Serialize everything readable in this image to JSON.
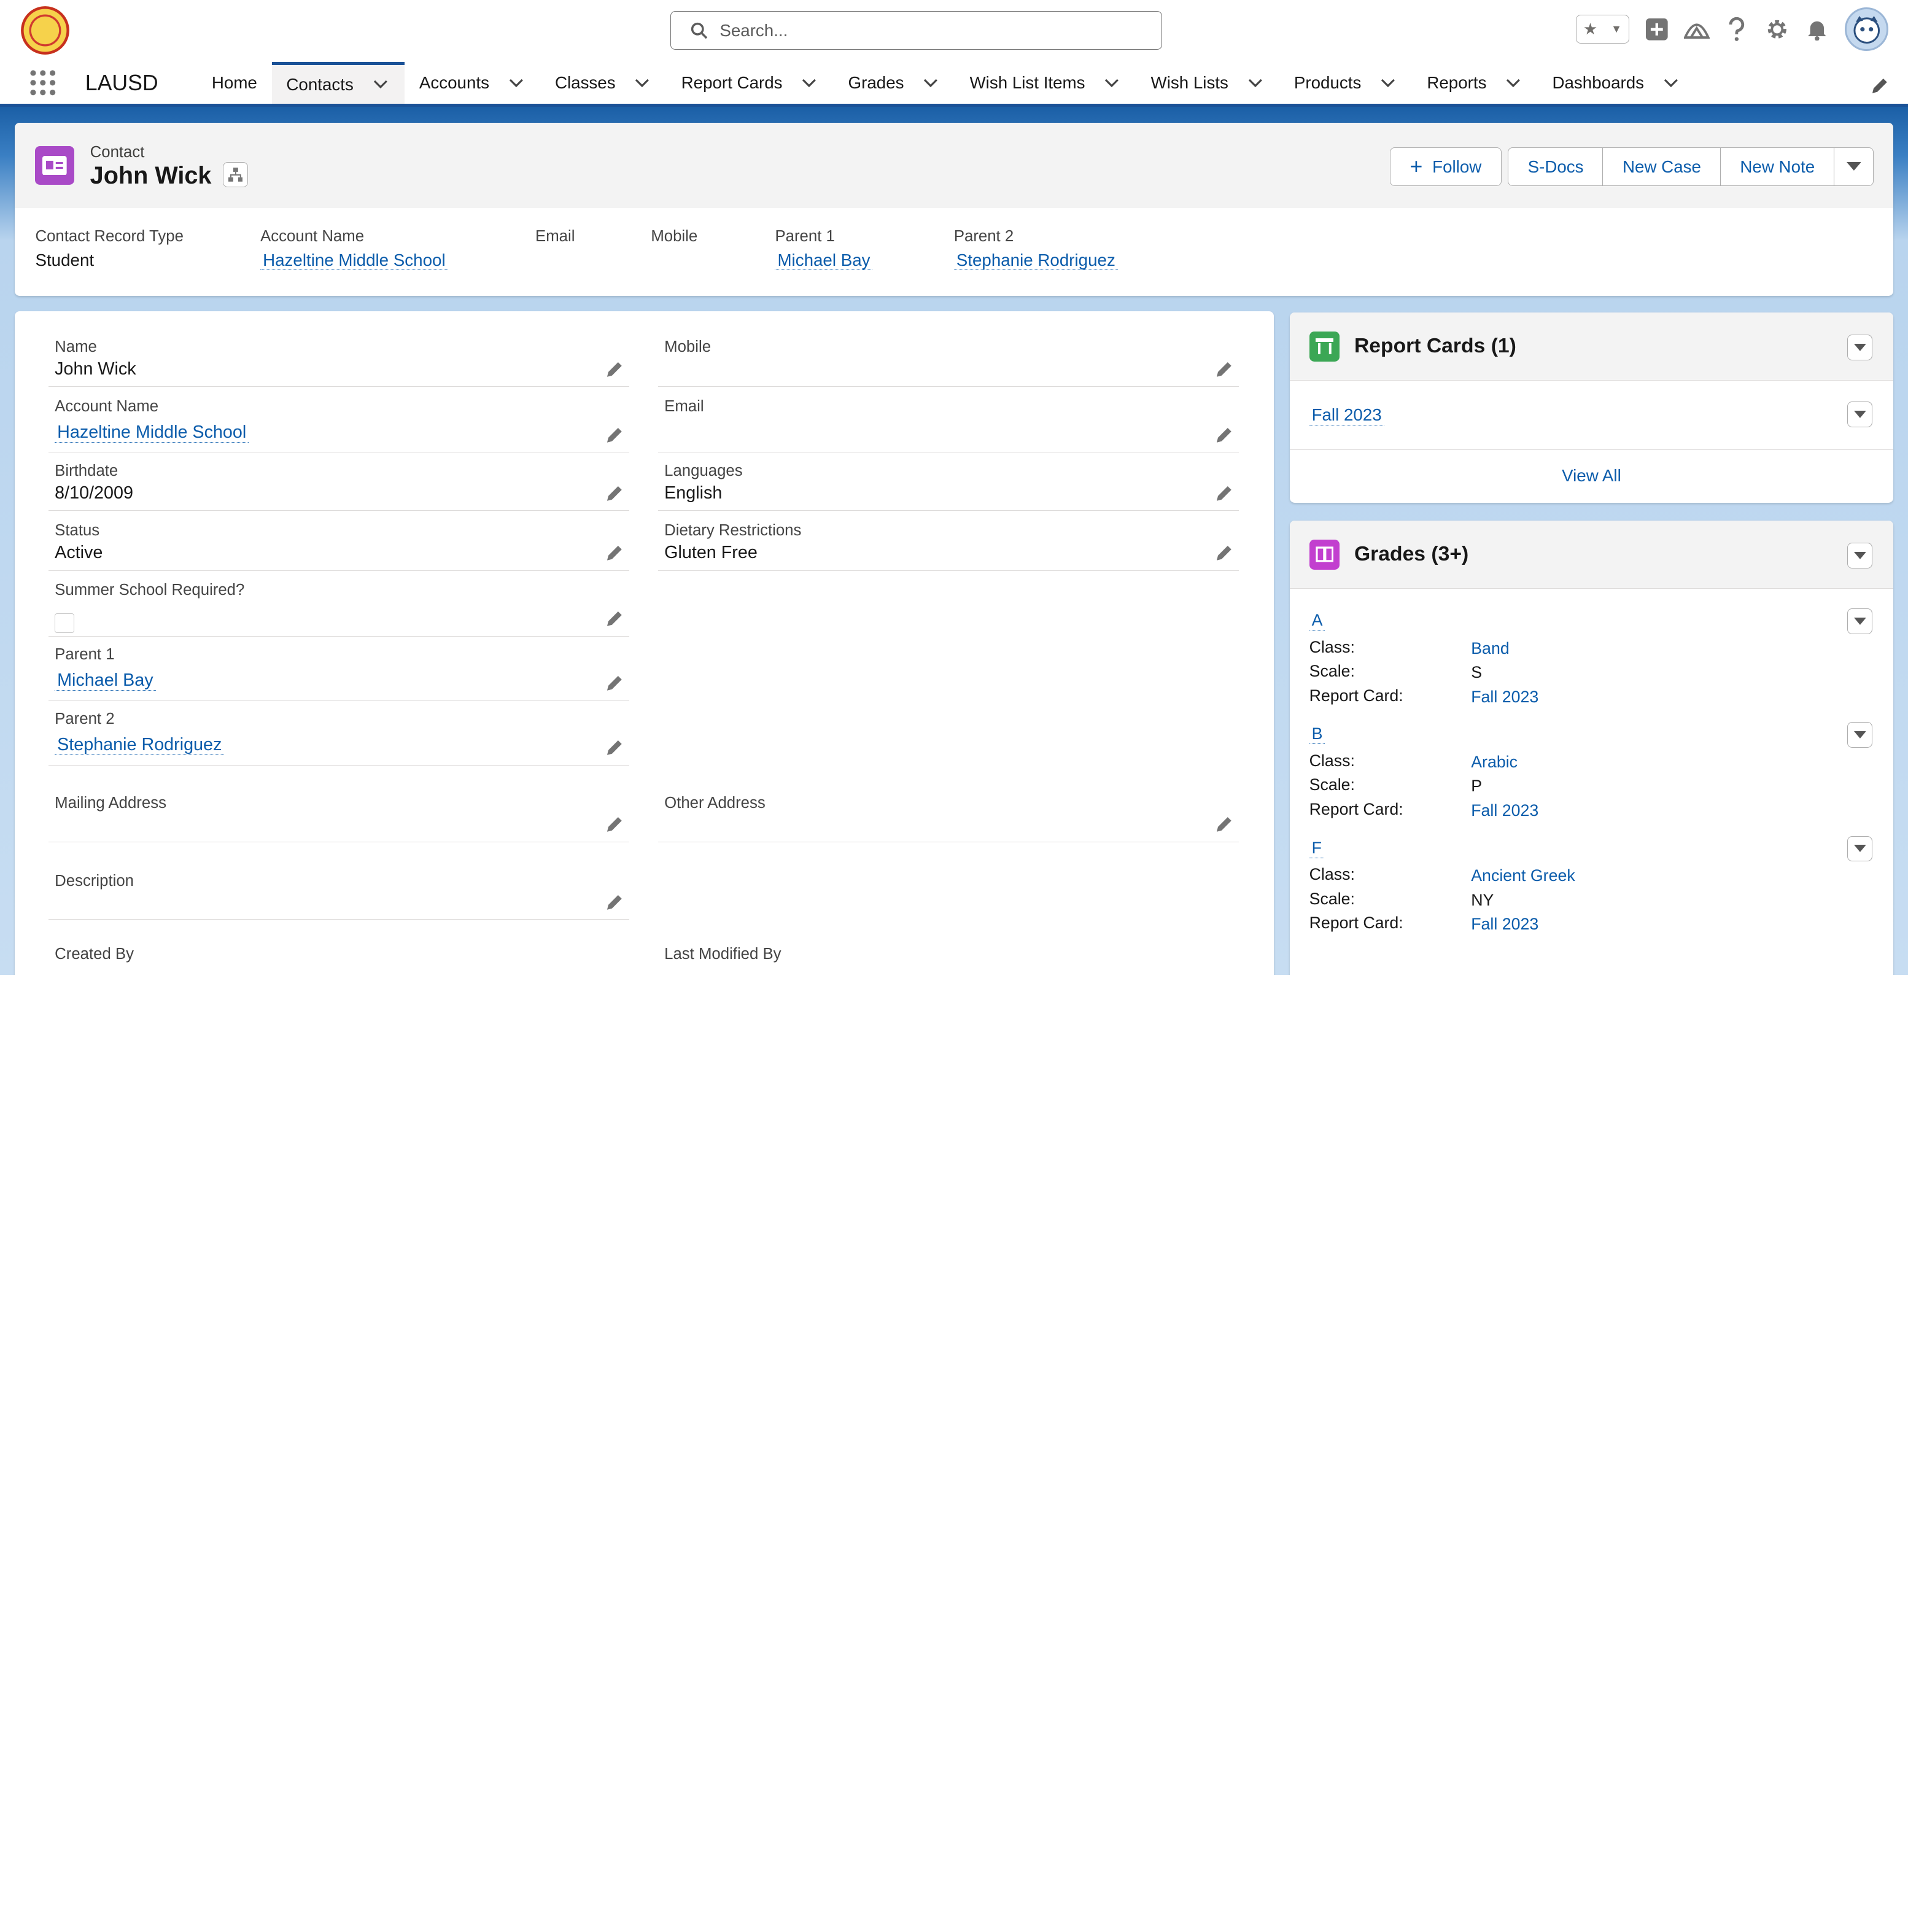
{
  "header": {
    "search_placeholder": "Search..."
  },
  "nav": {
    "app_name": "LAUSD",
    "tabs": [
      {
        "label": "Home",
        "chevron": false
      },
      {
        "label": "Contacts",
        "chevron": true,
        "active": true
      },
      {
        "label": "Accounts",
        "chevron": true
      },
      {
        "label": "Classes",
        "chevron": true
      },
      {
        "label": "Report Cards",
        "chevron": true
      },
      {
        "label": "Grades",
        "chevron": true
      },
      {
        "label": "Wish List Items",
        "chevron": true
      },
      {
        "label": "Wish Lists",
        "chevron": true
      },
      {
        "label": "Products",
        "chevron": true
      },
      {
        "label": "Reports",
        "chevron": true
      },
      {
        "label": "Dashboards",
        "chevron": true
      }
    ]
  },
  "record": {
    "object_label": "Contact",
    "name": "John Wick"
  },
  "actions": {
    "follow": "Follow",
    "sdocs": "S-Docs",
    "new_case": "New Case",
    "new_note": "New Note"
  },
  "highlights": [
    {
      "label": "Contact Record Type",
      "value": "Student",
      "link": false
    },
    {
      "label": "Account Name",
      "value": "Hazeltine Middle School",
      "link": true
    },
    {
      "label": "Email",
      "value": "",
      "link": false
    },
    {
      "label": "Mobile",
      "value": "",
      "link": false
    },
    {
      "label": "Parent 1",
      "value": "Michael Bay",
      "link": true
    },
    {
      "label": "Parent 2",
      "value": "Stephanie Rodriguez",
      "link": true
    }
  ],
  "details": {
    "name": {
      "label": "Name",
      "value": "John Wick"
    },
    "mobile": {
      "label": "Mobile",
      "value": ""
    },
    "account": {
      "label": "Account Name",
      "value": "Hazeltine Middle School"
    },
    "email": {
      "label": "Email",
      "value": ""
    },
    "birthdate": {
      "label": "Birthdate",
      "value": "8/10/2009"
    },
    "languages": {
      "label": "Languages",
      "value": "English"
    },
    "status": {
      "label": "Status",
      "value": "Active"
    },
    "dietary": {
      "label": "Dietary Restrictions",
      "value": "Gluten Free"
    },
    "summer": {
      "label": "Summer School Required?",
      "checked": false
    },
    "parent1": {
      "label": "Parent 1",
      "value": "Michael Bay"
    },
    "parent2": {
      "label": "Parent 2",
      "value": "Stephanie Rodriguez"
    },
    "mailing": {
      "label": "Mailing Address",
      "value": ""
    },
    "other": {
      "label": "Other Address",
      "value": ""
    },
    "description": {
      "label": "Description",
      "value": ""
    },
    "created_by": {
      "label": "Created By"
    },
    "modified_by": {
      "label": "Last Modified By"
    }
  },
  "report_cards": {
    "title": "Report Cards (1)",
    "items": [
      "Fall 2023"
    ],
    "view_all": "View All",
    "accent": "#3ba755"
  },
  "grades": {
    "title": "Grades (3+)",
    "accent": "#c23fcf",
    "labels": {
      "class": "Class:",
      "scale": "Scale:",
      "report_card": "Report Card:"
    },
    "items": [
      {
        "grade": "A",
        "class": "Band",
        "scale": "S",
        "report_card": "Fall 2023"
      },
      {
        "grade": "B",
        "class": "Arabic",
        "scale": "P",
        "report_card": "Fall 2023"
      },
      {
        "grade": "F",
        "class": "Ancient Greek",
        "scale": "NY",
        "report_card": "Fall 2023"
      }
    ]
  }
}
